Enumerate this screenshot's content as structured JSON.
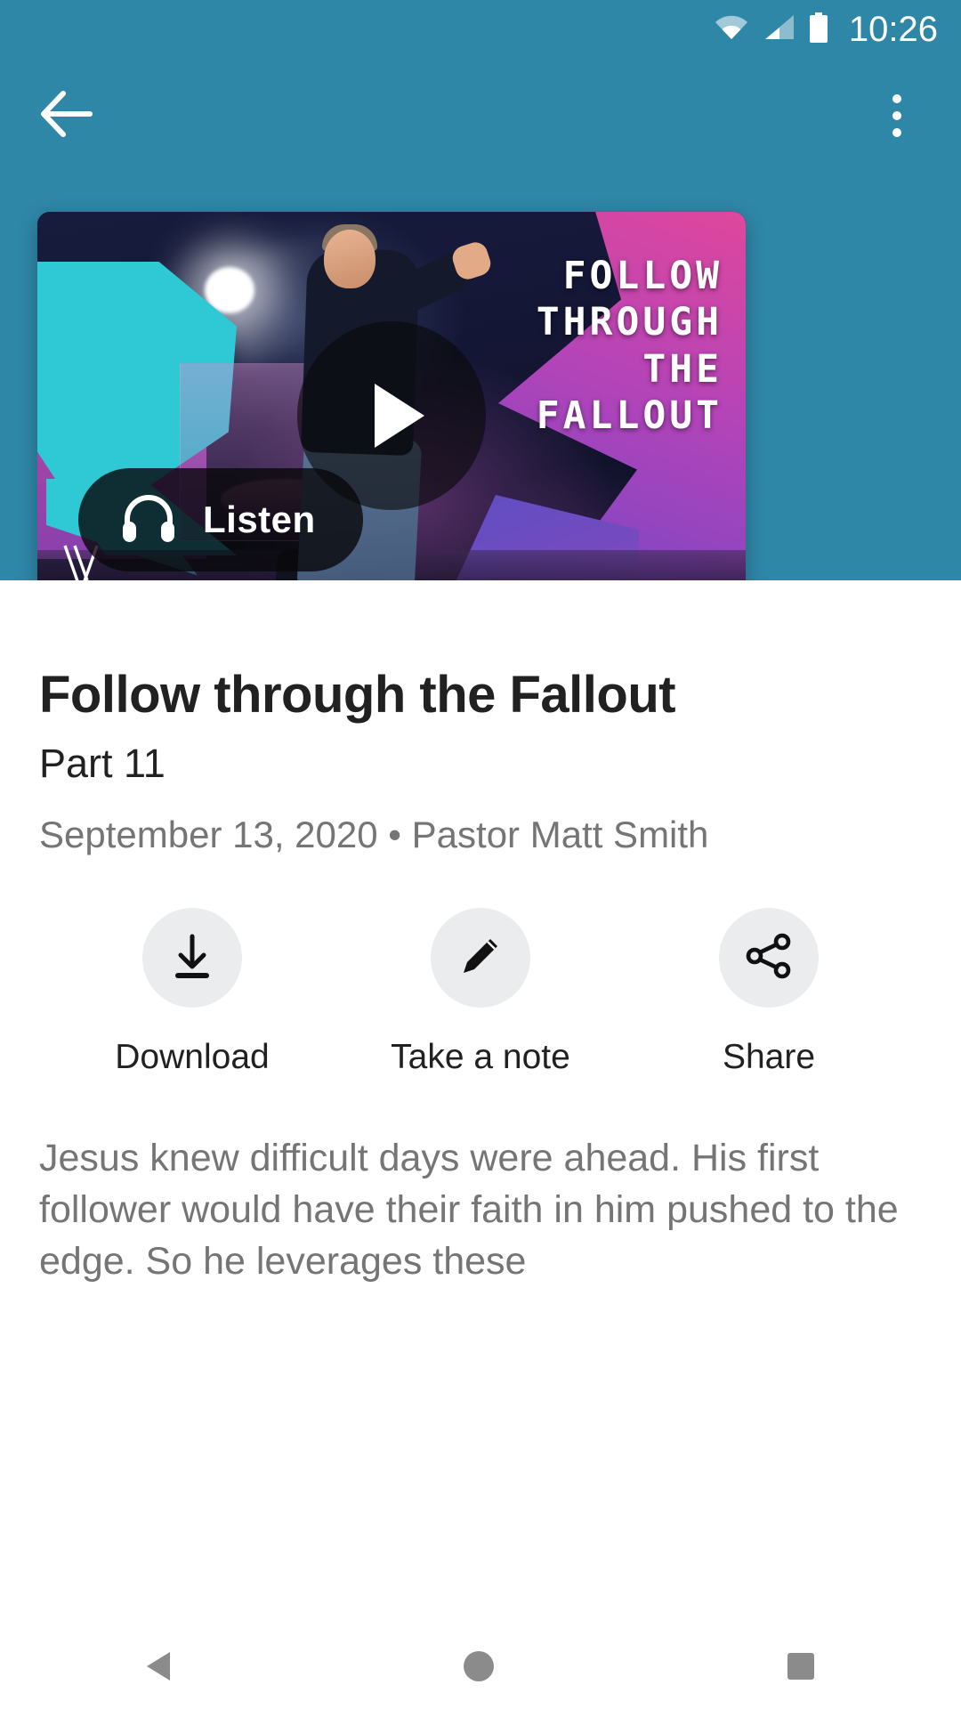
{
  "status_bar": {
    "time": "10:26",
    "icons": [
      "wifi-icon",
      "cellular-signal-icon",
      "battery-icon"
    ]
  },
  "app_bar": {
    "back_icon": "back-arrow-icon",
    "overflow_icon": "overflow-menu-icon",
    "background_color": "#2f87a8"
  },
  "video_card": {
    "artwork_title_lines": [
      "FOLLOW",
      "THROUGH",
      "THE",
      "FALLOUT"
    ],
    "play_button_label": "play-button",
    "listen_button_label": "Listen",
    "listen_icon": "headphones-icon",
    "logo": "V"
  },
  "episode": {
    "title": "Follow through the Fallout",
    "part": "Part 11",
    "meta": "September 13, 2020 • Pastor Matt Smith",
    "description": "Jesus knew difficult days were ahead. His first follower would have their faith in him pushed to the edge. So he leverages these"
  },
  "actions": [
    {
      "label": "Download",
      "icon": "download-icon"
    },
    {
      "label": "Take a note",
      "icon": "pencil-icon"
    },
    {
      "label": "Share",
      "icon": "share-icon"
    }
  ],
  "nav_bar": {
    "back": "nav-back-icon",
    "home": "nav-home-icon",
    "recents": "nav-recents-icon"
  },
  "colors": {
    "accent_teal": "#2f87a8",
    "text_primary": "#212121",
    "text_secondary": "#757575",
    "chip_gray": "#ebecee"
  }
}
